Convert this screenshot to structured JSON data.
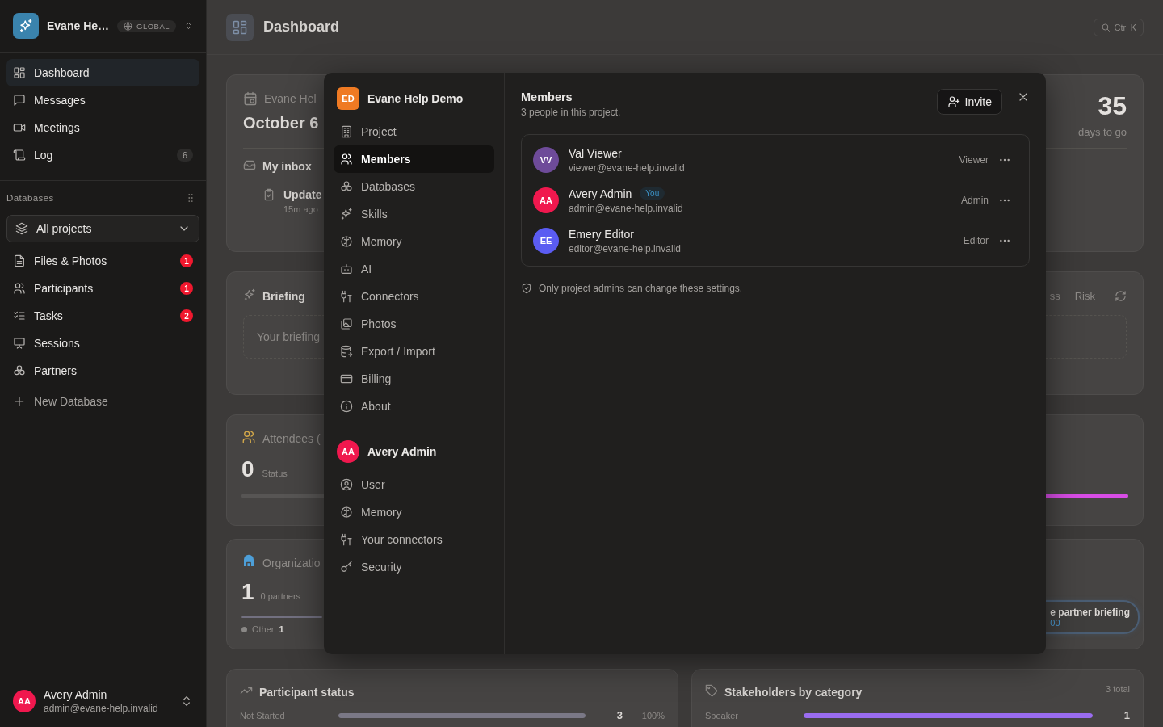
{
  "sidebar": {
    "workspace": {
      "name": "Evane He…",
      "scope": "GLOBAL"
    },
    "nav": [
      {
        "label": "Dashboard",
        "selected": true
      },
      {
        "label": "Messages",
        "selected": false
      },
      {
        "label": "Meetings",
        "selected": false
      },
      {
        "label": "Log",
        "selected": false,
        "badge": "6"
      }
    ],
    "databases": {
      "title": "Databases",
      "filter": "All projects",
      "items": [
        {
          "label": "Files & Photos",
          "selected": false,
          "badge": "1"
        },
        {
          "label": "Participants",
          "selected": false,
          "badge": "1"
        },
        {
          "label": "Tasks",
          "selected": false,
          "badge": "2"
        },
        {
          "label": "Sessions",
          "selected": false
        },
        {
          "label": "Partners",
          "selected": false
        }
      ],
      "add": "New Database"
    },
    "user": {
      "initials": "AA",
      "name": "Avery Admin",
      "email": "admin@evane-help.invalid"
    }
  },
  "header": {
    "title": "Dashboard",
    "shortcut": "Ctrl K"
  },
  "dashboard": {
    "event": {
      "project": "Evane Hel",
      "date": "October 6",
      "countdown": "35",
      "countdown_label": "days to go",
      "inbox_title": "My inbox",
      "inbox_items": [
        {
          "title": "Update",
          "time": "15m ago"
        }
      ]
    },
    "briefing": {
      "title": "Briefing",
      "tabs": [
        {
          "label": "ss",
          "selected": false
        },
        {
          "label": "Risk",
          "selected": false
        }
      ],
      "placeholder": "Your briefing"
    },
    "attendees": {
      "title": "Attendees (",
      "count": "0",
      "caption": "Status",
      "level": 0.1
    },
    "organizations": {
      "title": "Organizatio",
      "count": "1",
      "caption": "0 partners",
      "level": 1,
      "legend": [
        {
          "label": "Other",
          "count": "1",
          "color": "#8a8886"
        }
      ],
      "action": {
        "label": "e partner briefing",
        "sublabel": "00"
      }
    },
    "participant_status": {
      "title": "Participant status",
      "rows": [
        {
          "label": "Not Started",
          "count": "3",
          "percent": "100%",
          "level": 1
        }
      ]
    },
    "stakeholders": {
      "title": "Stakeholders by category",
      "total": "3 total",
      "rows": [
        {
          "label": "Speaker",
          "count": "1",
          "level": 1
        }
      ]
    }
  },
  "settings_dialog": {
    "project": {
      "initials": "ED",
      "name": "Evane Help Demo"
    },
    "project_nav": [
      {
        "label": "Project",
        "selected": false
      },
      {
        "label": "Members",
        "selected": true
      },
      {
        "label": "Databases",
        "selected": false
      },
      {
        "label": "Skills",
        "selected": false
      },
      {
        "label": "Memory",
        "selected": false
      },
      {
        "label": "AI",
        "selected": false
      },
      {
        "label": "Connectors",
        "selected": false
      },
      {
        "label": "Photos",
        "selected": false
      },
      {
        "label": "Export / Import",
        "selected": false
      },
      {
        "label": "Billing",
        "selected": false
      },
      {
        "label": "About",
        "selected": false
      }
    ],
    "user": {
      "initials": "AA",
      "name": "Avery Admin"
    },
    "user_nav": [
      {
        "label": "User",
        "selected": false
      },
      {
        "label": "Memory",
        "selected": false
      },
      {
        "label": "Your connectors",
        "selected": false
      },
      {
        "label": "Security",
        "selected": false
      }
    ],
    "title": "Members",
    "subtitle": "3 people in this project.",
    "invite": "Invite",
    "members": [
      {
        "initials": "VV",
        "name": "Val Viewer",
        "email": "viewer@evane-help.invalid",
        "role": "Viewer",
        "color": "#6e4b99"
      },
      {
        "initials": "AA",
        "name": "Avery Admin",
        "email": "admin@evane-help.invalid",
        "role": "Admin",
        "color": "#f0184e",
        "badge": "You"
      },
      {
        "initials": "EE",
        "name": "Emery Editor",
        "email": "editor@evane-help.invalid",
        "role": "Editor",
        "color": "#5b5cf2"
      }
    ],
    "note": "Only project admins can change these settings."
  }
}
